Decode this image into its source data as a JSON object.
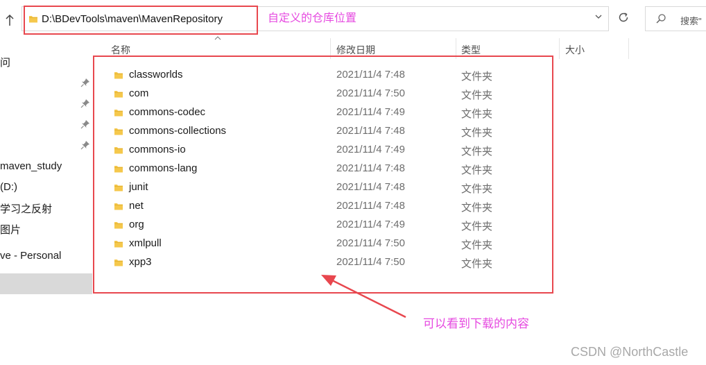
{
  "address": {
    "path": "D:\\BDevTools\\maven\\MavenRepository"
  },
  "search": {
    "placeholder": "搜索\""
  },
  "annotations": {
    "repo_location": "自定义的仓库位置",
    "downloaded_content": "可以看到下载的内容"
  },
  "nav": {
    "items": [
      {
        "label": "问"
      },
      {
        "label": "maven_study"
      },
      {
        "label": "(D:)"
      },
      {
        "label": "学习之反射"
      },
      {
        "label": "图片"
      },
      {
        "label": "ve - Personal"
      }
    ]
  },
  "columns": {
    "name": "名称",
    "modified": "修改日期",
    "type": "类型",
    "size": "大小"
  },
  "files": [
    {
      "name": "classworlds",
      "modified": "2021/11/4 7:48",
      "type": "文件夹"
    },
    {
      "name": "com",
      "modified": "2021/11/4 7:50",
      "type": "文件夹"
    },
    {
      "name": "commons-codec",
      "modified": "2021/11/4 7:49",
      "type": "文件夹"
    },
    {
      "name": "commons-collections",
      "modified": "2021/11/4 7:48",
      "type": "文件夹"
    },
    {
      "name": "commons-io",
      "modified": "2021/11/4 7:49",
      "type": "文件夹"
    },
    {
      "name": "commons-lang",
      "modified": "2021/11/4 7:48",
      "type": "文件夹"
    },
    {
      "name": "junit",
      "modified": "2021/11/4 7:48",
      "type": "文件夹"
    },
    {
      "name": "net",
      "modified": "2021/11/4 7:48",
      "type": "文件夹"
    },
    {
      "name": "org",
      "modified": "2021/11/4 7:49",
      "type": "文件夹"
    },
    {
      "name": "xmlpull",
      "modified": "2021/11/4 7:50",
      "type": "文件夹"
    },
    {
      "name": "xpp3",
      "modified": "2021/11/4 7:50",
      "type": "文件夹"
    }
  ],
  "watermark": "CSDN @NorthCastle",
  "colors": {
    "annotation_box": "#e8474e",
    "annotation_text": "#e64ae0",
    "folder_icon": "#f5c84c"
  },
  "icons": {
    "up": "up-arrow-icon",
    "folder": "folder-icon",
    "dropdown": "chevron-down-icon",
    "refresh": "refresh-icon",
    "search": "search-icon",
    "pin": "pin-icon"
  }
}
